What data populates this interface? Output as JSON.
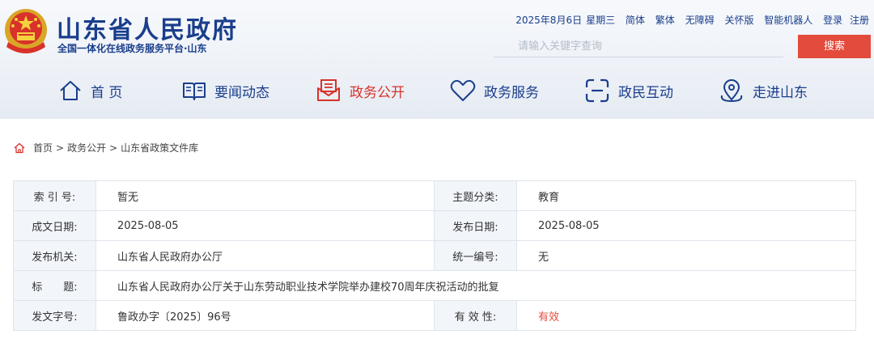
{
  "header": {
    "site_name": "山东省人民政府",
    "site_sub": "全国一体化在线政务服务平台·山东",
    "date": "2025年8月6日",
    "weekday": "星期三",
    "links": [
      "简体",
      "繁体",
      "无障碍",
      "关怀版",
      "智能机器人",
      "登录",
      "注册"
    ],
    "search_placeholder": "请输入关键字查询",
    "search_button": "搜索"
  },
  "nav": [
    {
      "label": "首 页",
      "icon": "home-icon"
    },
    {
      "label": "要闻动态",
      "icon": "book-icon"
    },
    {
      "label": "政务公开",
      "icon": "envelope-icon",
      "active": true
    },
    {
      "label": "政务服务",
      "icon": "heart-icon"
    },
    {
      "label": "政民互动",
      "icon": "interaction-icon"
    },
    {
      "label": "走进山东",
      "icon": "location-icon"
    }
  ],
  "breadcrumb": [
    "首页",
    "政务公开",
    "山东省政策文件库"
  ],
  "info": {
    "index_label": "索 引 号:",
    "index_value": "暂无",
    "topic_label": "主题分类:",
    "topic_value": "教育",
    "written_label": "成文日期:",
    "written_value": "2025-08-05",
    "published_label": "发布日期:",
    "published_value": "2025-08-05",
    "issuer_label": "发布机关:",
    "issuer_value": "山东省人民政府办公厅",
    "serial_label": "统一编号:",
    "serial_value": "无",
    "title_label": "标　　题:",
    "title_value": "山东省人民政府办公厅关于山东劳动职业技术学院举办建校70周年庆祝活动的批复",
    "docno_label": "发文字号:",
    "docno_value": "鲁政办字〔2025〕96号",
    "validity_label": "有 效 性:",
    "validity_value": "有效"
  },
  "colors": {
    "brand_blue": "#1a3e8c",
    "accent_red": "#e34b3c",
    "active_red": "#d8322a",
    "label_bg": "#f2f5fa"
  }
}
